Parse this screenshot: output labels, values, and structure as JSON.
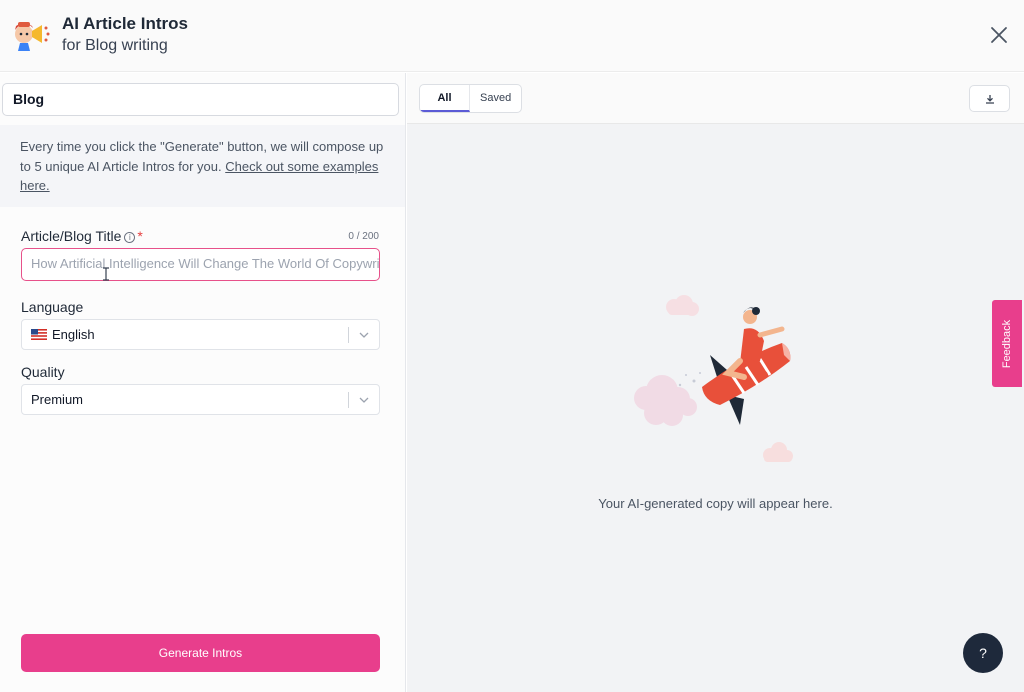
{
  "header": {
    "title": "AI Article Intros",
    "subtitle": "for Blog writing",
    "logo_icon": "megaphone-mascot-icon",
    "close_icon": "close-icon"
  },
  "left_panel": {
    "topic_value": "Blog",
    "info_text": "Every time you click the \"Generate\" button, we will compose up to 5 unique AI Article Intros for you. ",
    "info_link": "Check out some examples here.",
    "title_field": {
      "label": "Article/Blog Title",
      "required_mark": "*",
      "info_icon": "info-icon",
      "counter": "0 / 200",
      "placeholder": "How Artificial Intelligence Will Change The World Of Copywriting"
    },
    "language": {
      "label": "Language",
      "value": "English",
      "flag_icon": "us-flag-icon"
    },
    "quality": {
      "label": "Quality",
      "value": "Premium"
    },
    "generate_button": "Generate Intros"
  },
  "right_panel": {
    "tabs": [
      {
        "label": "All",
        "active": true
      },
      {
        "label": "Saved",
        "active": false
      }
    ],
    "download_icon": "download-icon",
    "illustration": "rocket-rider-illustration",
    "empty_text": "Your AI-generated copy will appear here."
  },
  "feedback_tab": "Feedback",
  "help_button": "?",
  "colors": {
    "accent": "#e83e8c",
    "tab_indicator": "#5b5bd6",
    "help_bg": "#1e293b"
  }
}
